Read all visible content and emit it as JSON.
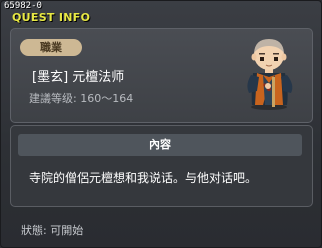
{
  "window": {
    "id": "65982-0",
    "title": "QUEST INFO"
  },
  "quest": {
    "job_badge": "職業",
    "npc_name": "[墨玄] 元檀法师",
    "level_req": "建議等级: 160～164",
    "content_header": "內容",
    "content_text": "寺院的僧侶元檀想和我说话。与他对话吧。",
    "status": "狀態: 可開始"
  },
  "icons": {
    "npc_portrait": "monk-npc-icon"
  },
  "colors": {
    "title": "#e8e844",
    "badge_bg": "#cdb894"
  }
}
